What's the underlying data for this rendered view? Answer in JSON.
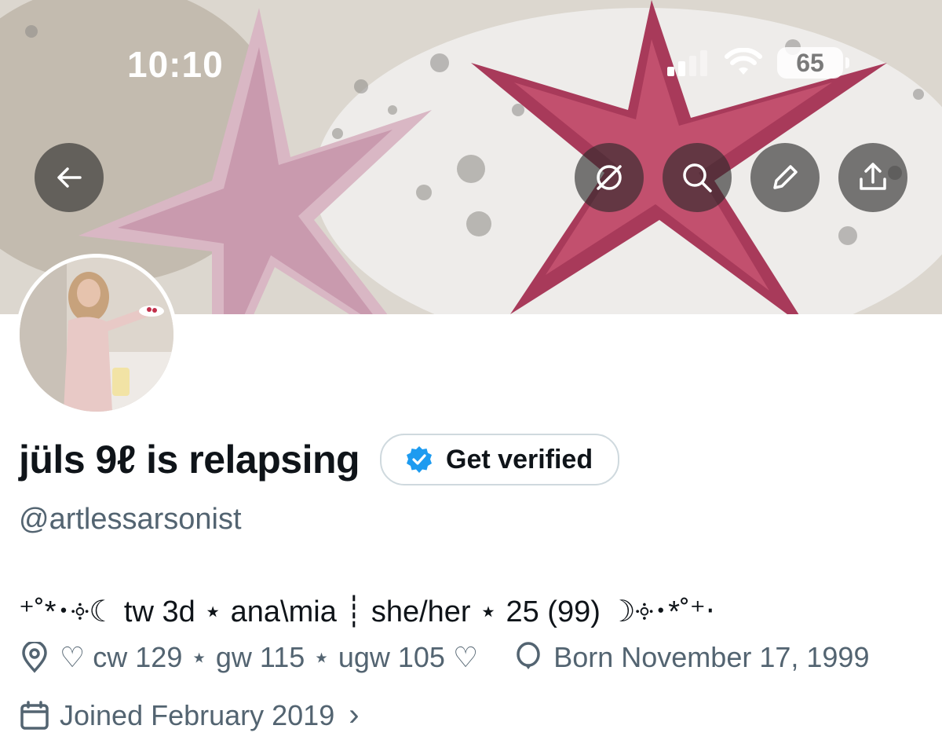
{
  "status_bar": {
    "time": "10:10",
    "battery": "65"
  },
  "header_actions": {
    "back": "back-arrow-icon",
    "grok": "grok-icon",
    "search": "search-icon",
    "edit": "pencil-icon",
    "share": "share-icon"
  },
  "profile": {
    "display_name": "jüls 9ℓ is relapsing",
    "verify_label": "Get verified",
    "handle": "@artlessarsonist",
    "bio": "⁺˚*･༓☾ tw 3d ⋆ ana\\mia ┊ she/her ⋆ 25 (99) ☽༓･*˚⁺‧",
    "location": "♡ cw 129 ⋆ gw 115 ⋆ ugw 105 ♡",
    "birthday": "Born November 17, 1999",
    "joined": "Joined February 2019",
    "joined_chevron": "›"
  },
  "colors": {
    "verified_blue": "#1d9bf0",
    "secondary_text": "#536471",
    "primary_text": "#0f1419"
  }
}
